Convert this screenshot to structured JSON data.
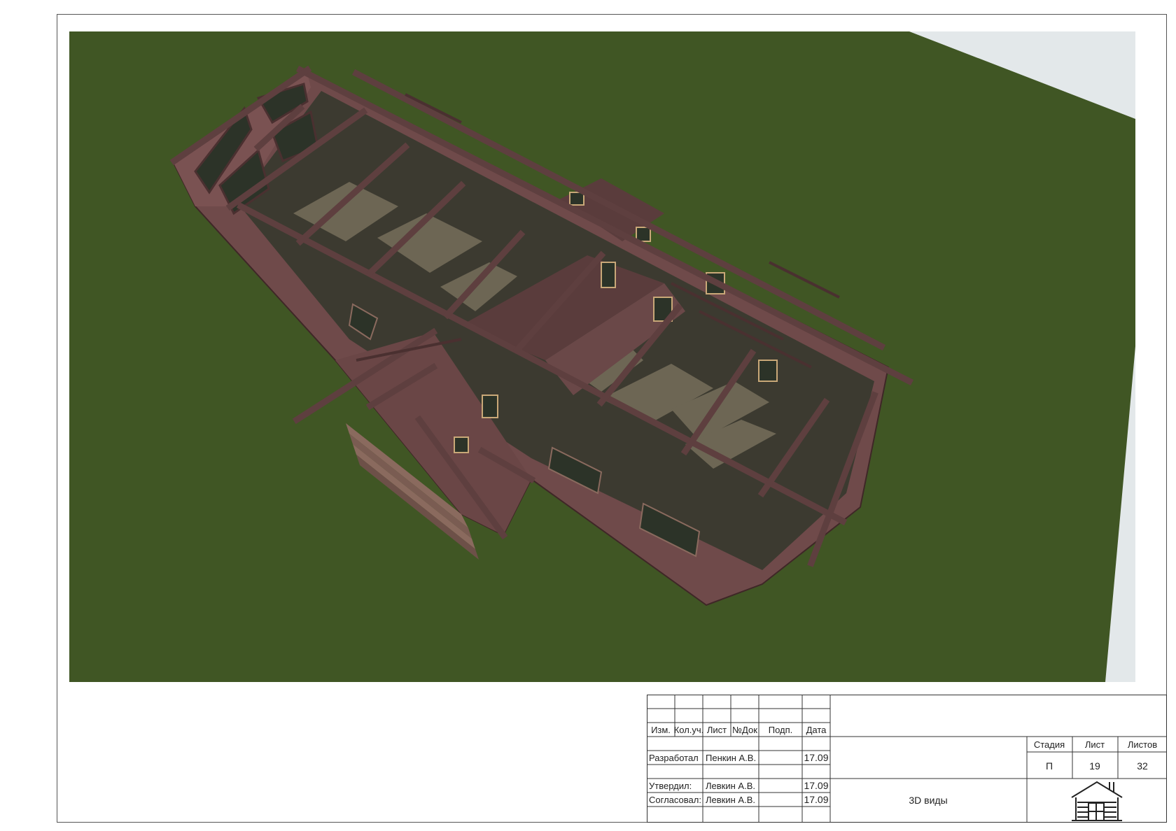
{
  "title_block": {
    "headers": {
      "izm": "Изм.",
      "kol_uch": "Кол.уч.",
      "list": "Лист",
      "doc_no": "№Док",
      "podp": "Подп.",
      "data": "Дата"
    },
    "rows": [
      {
        "role": "Разработал",
        "name": "Пенкин А.В.",
        "date": "17.09"
      },
      {
        "role": "Утвердил:",
        "name": "Левкин А.В.",
        "date": "17.09"
      },
      {
        "role": "Согласовал:",
        "name": "Левкин А.В.",
        "date": "17.09"
      }
    ],
    "sheet_title": "3D виды",
    "stage_header": "Стадия",
    "sheet_header": "Лист",
    "sheets_header": "Листов",
    "stage": "П",
    "sheet": "19",
    "sheets": "32",
    "logo_icon": "log-house-icon"
  },
  "colors": {
    "grass": "#405624",
    "log_wall": "#6f4a4a",
    "timber_beam": "#5e3f3f",
    "floor": "#3c3a30",
    "floor_lit": "#6d6654",
    "window": "#2c3328",
    "sky": "#e3e8ea"
  }
}
